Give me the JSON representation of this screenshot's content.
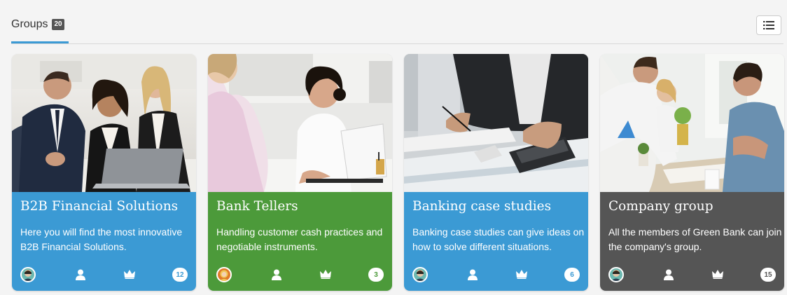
{
  "header": {
    "title": "Groups",
    "count": "20",
    "list_view_icon": "list-icon",
    "accent": "#3b9ad4"
  },
  "groups": [
    {
      "title": "B2B Financial Solutions",
      "description": "Here you will find the most innovative B2B Financial Solutions.",
      "color": "#3b9ad4",
      "member_count": "12",
      "image": "business-team-photo",
      "avatar": "man-avatar"
    },
    {
      "title": "Bank Tellers",
      "description": "Handling customer cash practices and negotiable instruments.",
      "color": "#4c9a3a",
      "member_count": "3",
      "image": "teller-meeting-photo",
      "avatar": "woman-avatar"
    },
    {
      "title": "Banking case studies",
      "description": "Banking case studies can give ideas on how to solve different situations.",
      "color": "#3b9ad4",
      "member_count": "6",
      "image": "calculator-photo",
      "avatar": "man-avatar"
    },
    {
      "title": "Company group",
      "description": "All the members of Green Bank can join the company's group.",
      "color": "#555555",
      "member_count": "15",
      "image": "office-team-photo",
      "avatar": "man-avatar"
    }
  ],
  "footer_icons": [
    "avatar",
    "member-icon",
    "crown-icon",
    "count-badge"
  ]
}
